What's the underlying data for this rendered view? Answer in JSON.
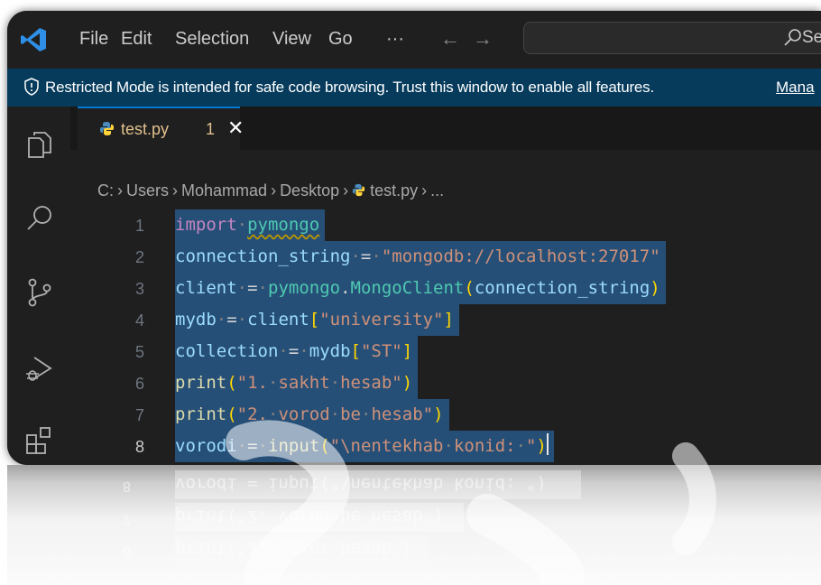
{
  "menubar": {
    "items": [
      "File",
      "Edit",
      "Selection",
      "View",
      "Go",
      "···"
    ],
    "back_arrow": "←",
    "forward_arrow": "→",
    "search_label": "Se"
  },
  "banner": {
    "text": "Restricted Mode is intended for safe code browsing. Trust this window to enable all features.",
    "link": "Mana"
  },
  "tab": {
    "name": "test.py",
    "problem_count": "1",
    "close": "✕"
  },
  "breadcrumb": {
    "drive": "C:",
    "parts": [
      "Users",
      "Mohammad",
      "Desktop",
      "test.py",
      "..."
    ],
    "separator": "›"
  },
  "editor": {
    "line_numbers": [
      "1",
      "2",
      "3",
      "4",
      "5",
      "6",
      "7",
      "8"
    ],
    "current_line": "8",
    "lines": [
      "import pymongo",
      "connection_string = \"mongodb://localhost:27017\"",
      "client = pymongo.MongoClient(connection_string)",
      "mydb = client[\"university\"]",
      "collection = mydb[\"ST\"]",
      "print(\"1. sakht hesab\")",
      "print(\"2. vorod be hesab\")",
      "vorodi = input(\"\\nentekhab konid: \")"
    ]
  },
  "reflection": {
    "line_numbers": [
      "8",
      "7",
      "6"
    ],
    "lines": [
      "vorodi = input(\"\\nentekhab konid: \")",
      "print(\"2. vorod be hesab\")",
      "print(\"1. sakht hesab\")"
    ]
  },
  "colors": {
    "selection": "#264f78",
    "banner": "#063b5c",
    "accent": "#0078d4"
  },
  "icons": [
    "vscode-logo",
    "search-icon",
    "shield-icon",
    "explorer-icon",
    "search-view-icon",
    "source-control-icon",
    "run-debug-icon",
    "extensions-icon",
    "python-file-icon",
    "close-icon"
  ]
}
